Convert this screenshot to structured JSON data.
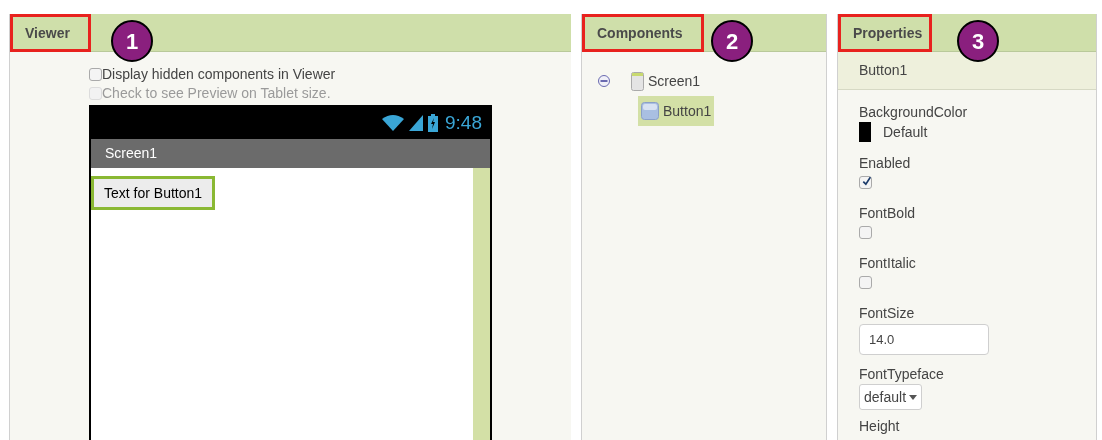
{
  "viewer": {
    "title": "Viewer",
    "marker": "1",
    "options": [
      {
        "label": "Display hidden components in Viewer",
        "checked": false,
        "disabled": false
      },
      {
        "label": "Check to see Preview on Tablet size.",
        "checked": false,
        "disabled": true
      }
    ],
    "phone": {
      "time": "9:48",
      "screen_title": "Screen1",
      "button_text": "Text for Button1",
      "button_selected": true
    }
  },
  "components": {
    "title": "Components",
    "marker": "2",
    "tree": [
      {
        "label": "Screen1",
        "expanded": true,
        "selected": false,
        "children": [
          {
            "label": "Button1",
            "selected": true
          }
        ]
      }
    ]
  },
  "properties": {
    "title": "Properties",
    "marker": "3",
    "component": "Button1",
    "props": [
      {
        "kind": "color",
        "label": "BackgroundColor",
        "value": "Default",
        "color": "#000000"
      },
      {
        "kind": "checkbox",
        "label": "Enabled",
        "checked": true
      },
      {
        "kind": "checkbox",
        "label": "FontBold",
        "checked": false
      },
      {
        "kind": "checkbox",
        "label": "FontItalic",
        "checked": false
      },
      {
        "kind": "text",
        "label": "FontSize",
        "value": "14.0"
      },
      {
        "kind": "dropdown",
        "label": "FontTypeface",
        "value": "default"
      },
      {
        "kind": "label",
        "label": "Height"
      }
    ]
  }
}
